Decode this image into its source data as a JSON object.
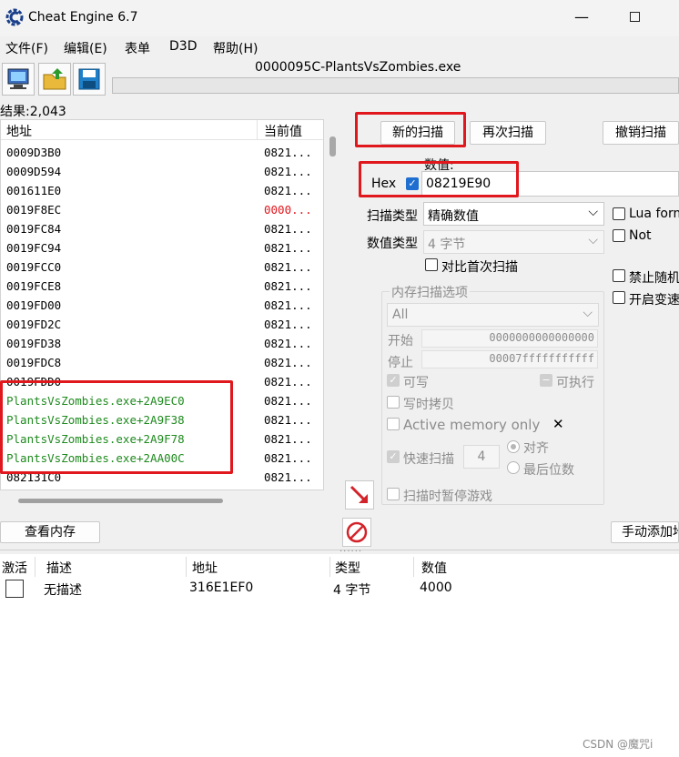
{
  "window": {
    "title": "Cheat Engine 6.7",
    "minimize": "—"
  },
  "menu": [
    "文件(F)",
    "编辑(E)",
    "表单",
    "D3D",
    "帮助(H)"
  ],
  "process_name": "0000095C-PlantsVsZombies.exe",
  "results_label": "结果:2,043",
  "list": {
    "headers": {
      "address": "地址",
      "value": "当前值"
    },
    "rows": [
      {
        "address": "0009D3B0",
        "value": "0821...",
        "color": "#000000"
      },
      {
        "address": "0009D594",
        "value": "0821...",
        "color": "#000000"
      },
      {
        "address": "001611E0",
        "value": "0821...",
        "color": "#000000"
      },
      {
        "address": "0019F8EC",
        "value": "0000...",
        "color": "#000000",
        "value_color": "#e0171d"
      },
      {
        "address": "0019FC84",
        "value": "0821...",
        "color": "#000000"
      },
      {
        "address": "0019FC94",
        "value": "0821...",
        "color": "#000000"
      },
      {
        "address": "0019FCC0",
        "value": "0821...",
        "color": "#000000"
      },
      {
        "address": "0019FCE8",
        "value": "0821...",
        "color": "#000000"
      },
      {
        "address": "0019FD00",
        "value": "0821...",
        "color": "#000000"
      },
      {
        "address": "0019FD2C",
        "value": "0821...",
        "color": "#000000"
      },
      {
        "address": "0019FD38",
        "value": "0821...",
        "color": "#000000"
      },
      {
        "address": "0019FDC8",
        "value": "0821...",
        "color": "#000000"
      },
      {
        "address": "0019FDD0",
        "value": "0821...",
        "color": "#000000"
      },
      {
        "address": "PlantsVsZombies.exe+2A9EC0",
        "value": "0821...",
        "color": "#1e8a1e"
      },
      {
        "address": "PlantsVsZombies.exe+2A9F38",
        "value": "0821...",
        "color": "#1e8a1e"
      },
      {
        "address": "PlantsVsZombies.exe+2A9F78",
        "value": "0821...",
        "color": "#1e8a1e"
      },
      {
        "address": "PlantsVsZombies.exe+2AA00C",
        "value": "0821...",
        "color": "#1e8a1e"
      },
      {
        "address": "082131C0",
        "value": "0821...",
        "color": "#000000"
      }
    ]
  },
  "buttons": {
    "new_scan": "新的扫描",
    "next_scan": "再次扫描",
    "undo_scan": "撤销扫描",
    "view_memory": "查看内存",
    "add_manual": "手动添加地址"
  },
  "value_section": {
    "label": "数值:",
    "hex_label": "Hex",
    "hex_checked": true,
    "value": "08219E90"
  },
  "scan_type": {
    "label": "扫描类型",
    "value": "精确数值"
  },
  "value_type": {
    "label": "数值类型",
    "value": "4 字节"
  },
  "compare_first": "对比首次扫描",
  "right_options": {
    "lua": "Lua formula",
    "not": "Not",
    "no_random": "禁止随机",
    "speedhack": "开启变速精灵"
  },
  "mem_options": {
    "title": "内存扫描选项",
    "region": "All",
    "start_label": "开始",
    "start_value": "0000000000000000",
    "stop_label": "停止",
    "stop_value": "00007fffffffffff",
    "writable": "可写",
    "executable": "可执行",
    "copy_on_write": "写时拷贝",
    "active_memory": "Active memory only",
    "fast_scan": "快速扫描",
    "fast_scan_value": "4",
    "align": "对齐",
    "last_digits": "最后位数",
    "pause_game": "扫描时暂停游戏"
  },
  "address_table": {
    "headers": [
      "激活",
      "描述",
      "地址",
      "类型",
      "数值"
    ],
    "rows": [
      {
        "description": "无描述",
        "address": "316E1EF0",
        "type": "4 字节",
        "value": "4000"
      }
    ]
  },
  "watermark": "CSDN @魔咒i",
  "colors": {
    "highlight": "#e0171d",
    "module_green": "#1e8a1e",
    "accent_blue": "#1f6fd0"
  }
}
